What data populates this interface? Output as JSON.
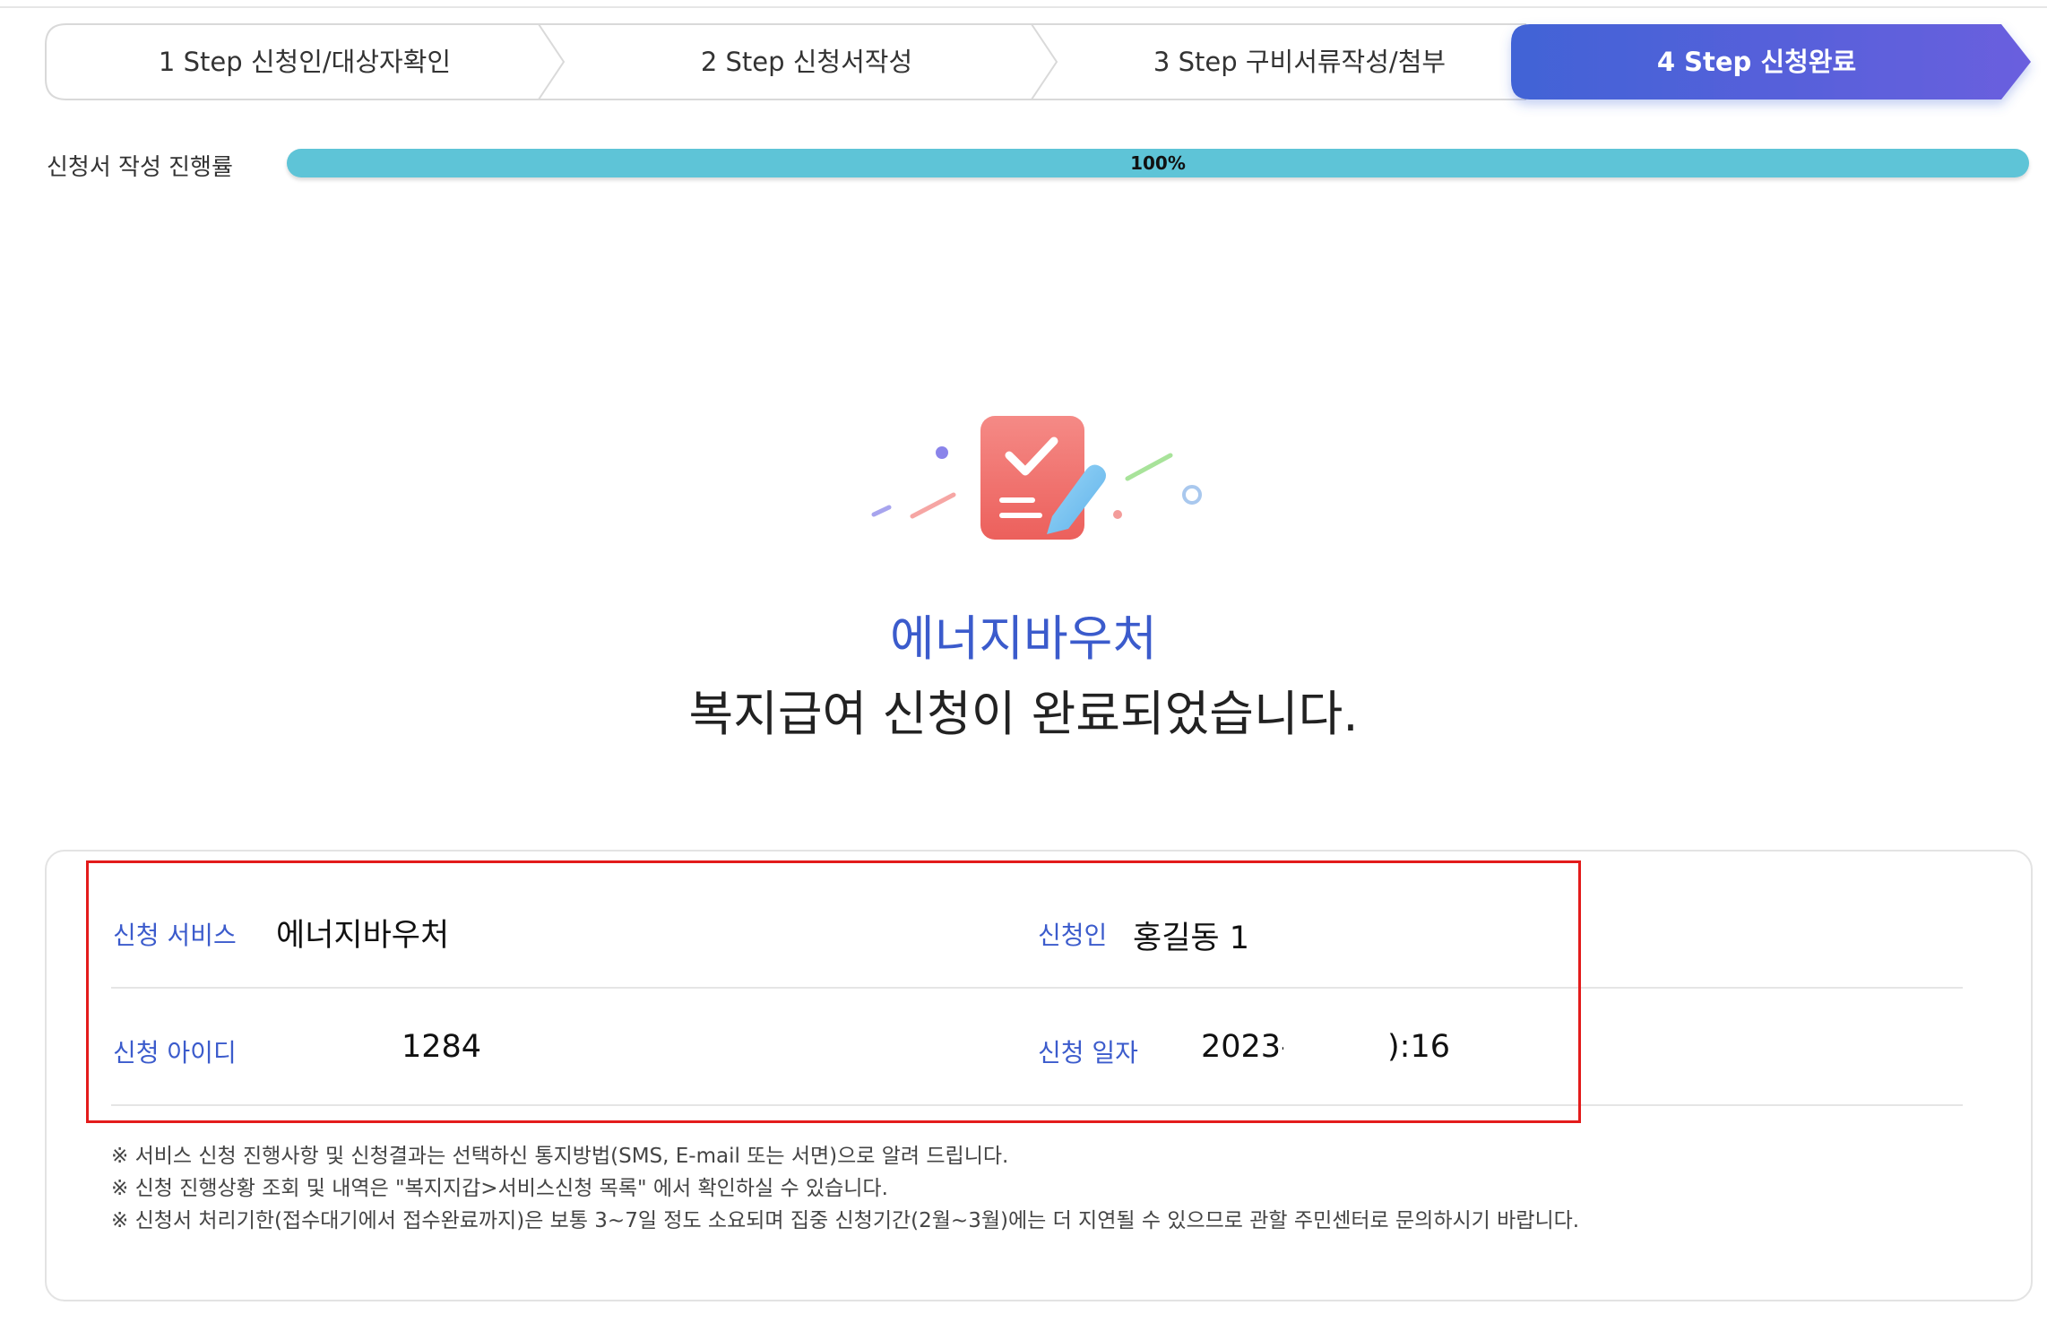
{
  "steps": [
    {
      "label": "1 Step 신청인/대상자확인",
      "active": false
    },
    {
      "label": "2 Step 신청서작성",
      "active": false
    },
    {
      "label": "3 Step 구비서류작성/첨부",
      "active": false
    },
    {
      "label": "4 Step 신청완료",
      "active": true
    }
  ],
  "progress": {
    "label": "신청서 작성 진행률",
    "percent": 100,
    "text": "100%",
    "color": "#5ec4d7"
  },
  "completion": {
    "service_title": "에너지바우처",
    "message": "복지급여 신청이 완료되었습니다."
  },
  "info": {
    "service_label": "신청 서비스",
    "service_value": "에너지바우처",
    "applicant_label": "신청인",
    "applicant_value": "홍길동 1",
    "id_label": "신청 아이디",
    "id_value": "1284",
    "date_label": "신청 일자",
    "date_value": "2023-(",
    "date_value_end": "):16"
  },
  "notes": [
    "※ 서비스 신청 진행사항 및 신청결과는 선택하신 통지방법(SMS, E-mail 또는 서면)으로 알려 드립니다.",
    "※ 신청 진행상황 조회 및 내역은 \"복지지갑>서비스신청 목록\" 에서 확인하실 수 있습니다.",
    "※ 신청서 처리기한(접수대기에서 접수완료까지)은 보통 3~7일 정도 소요되며 집중 신청기간(2월~3월)에는 더 지연될 수 있으므로 관할 주민센터로 문의하시기 바랍니다."
  ],
  "colors": {
    "accent": "#3b5bcc",
    "step_active_start": "#4163d6",
    "step_active_end": "#6a5fde",
    "highlight_border": "#e31b1b"
  }
}
